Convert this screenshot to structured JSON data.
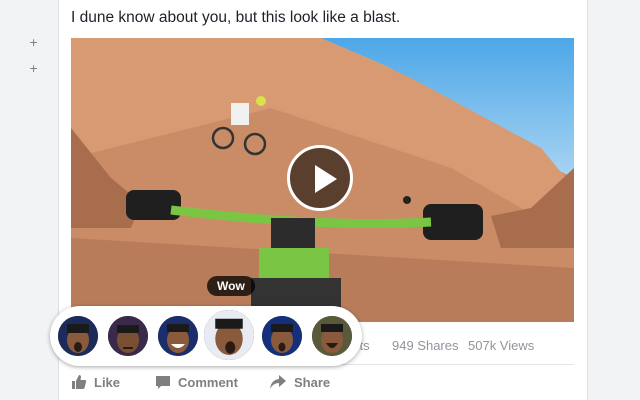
{
  "post": {
    "text": "I dune know about you, but this look like a blast."
  },
  "stats": {
    "comments_partial": "ents",
    "shares": "949 Shares",
    "views": "507k Views"
  },
  "actions": {
    "like": "Like",
    "comment": "Comment",
    "share": "Share"
  },
  "reactions": {
    "tooltip": "Wow",
    "count": 6
  },
  "gutter": {
    "plus_1": "+",
    "plus_2": "+"
  }
}
